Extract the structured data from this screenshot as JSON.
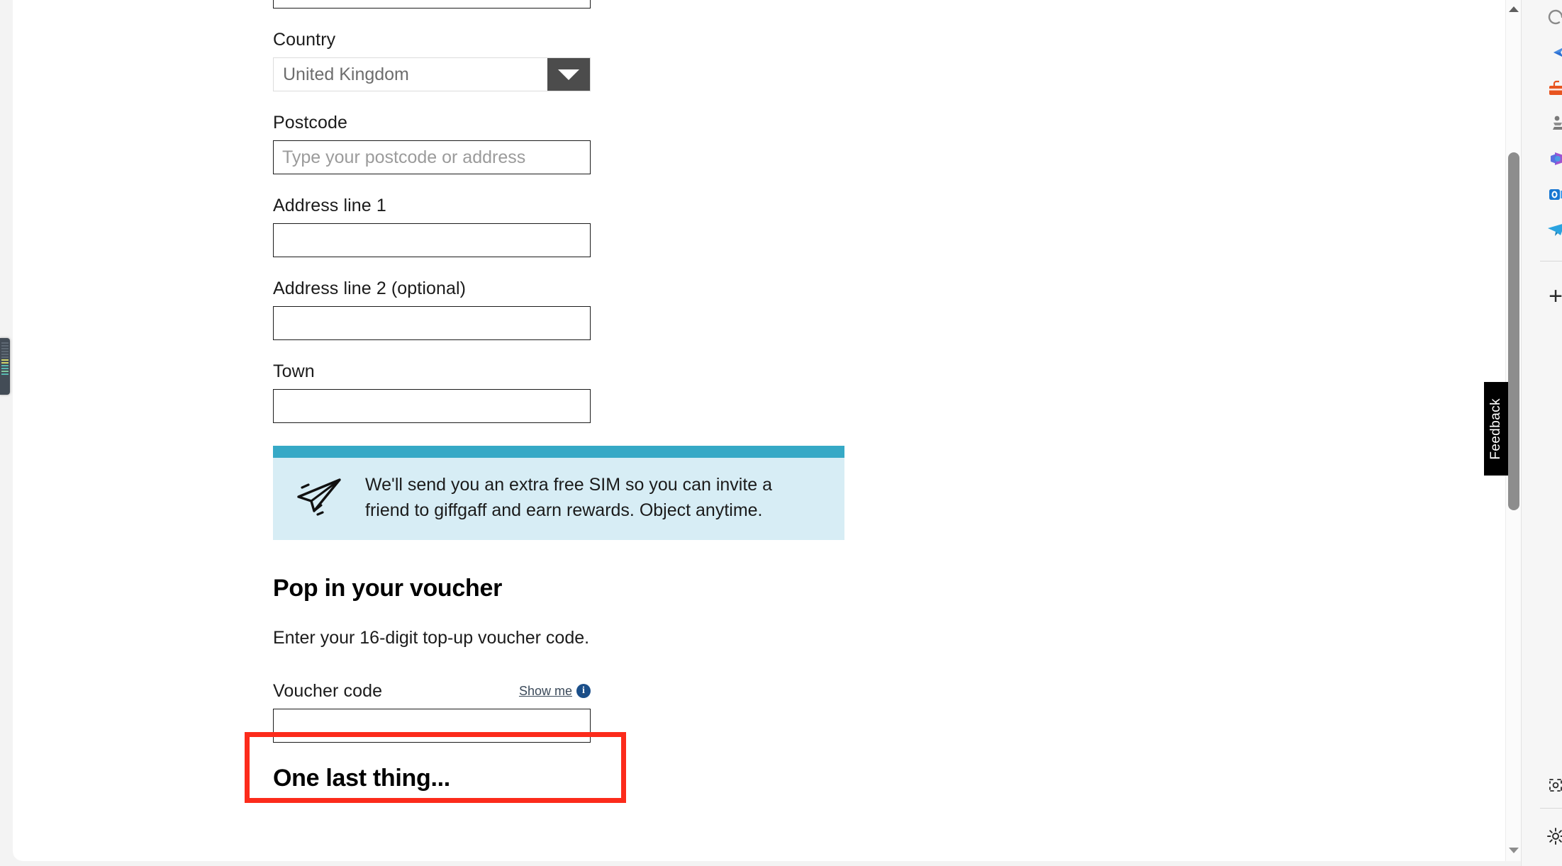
{
  "form": {
    "fields": [
      {
        "id": "top-cut-input",
        "label": "",
        "value": "",
        "placeholder": ""
      },
      {
        "id": "country",
        "label": "Country",
        "value": "United Kingdom",
        "placeholder": ""
      },
      {
        "id": "postcode",
        "label": "Postcode",
        "value": "",
        "placeholder": "Type your postcode or address"
      },
      {
        "id": "address-line-1",
        "label": "Address line 1",
        "value": "",
        "placeholder": ""
      },
      {
        "id": "address-line-2",
        "label": "Address line 2 (optional)",
        "value": "",
        "placeholder": ""
      },
      {
        "id": "town",
        "label": "Town",
        "value": "",
        "placeholder": ""
      }
    ]
  },
  "sim_banner": {
    "text": "We'll send you an extra free SIM so you can invite a friend to giffgaff and earn rewards. Object anytime.",
    "icon": "paper-plane-icon",
    "accent_color": "#36a9c6",
    "background_color": "#d7edf5"
  },
  "voucher": {
    "heading": "Pop in your voucher",
    "subtext": "Enter your 16-digit top-up voucher code.",
    "field_label": "Voucher code",
    "show_me_label": "Show me",
    "info_icon_glyph": "i",
    "input_value": "",
    "input_placeholder": ""
  },
  "last_section": {
    "heading": "One last thing..."
  },
  "annotation": {
    "color": "#fc2b1b",
    "target": "voucher-code-input"
  },
  "feedback_tab": {
    "label": "Feedback"
  },
  "page_scrollbar": {
    "up_arrow": "scroll-up-arrow",
    "down_arrow": "scroll-down-arrow"
  },
  "edge_sidebar": {
    "items": [
      {
        "name": "copilot-icon",
        "glyph": "◐",
        "color": "#8a8a8a"
      },
      {
        "name": "edge-drop-icon",
        "glyph": "◆",
        "color": "#2b6fd4"
      },
      {
        "name": "tools-icon",
        "glyph": "▣",
        "color": "#e8541f"
      },
      {
        "name": "games-icon",
        "glyph": "♟",
        "color": "#7a7a7a"
      },
      {
        "name": "office-icon",
        "glyph": "◈",
        "color": "#a052d0"
      },
      {
        "name": "outlook-icon",
        "glyph": "◎",
        "color": "#1877d2"
      },
      {
        "name": "telegram-icon",
        "glyph": "➤",
        "color": "#2aa3e0"
      }
    ],
    "add_app_label": "+",
    "customize_icon": "customize-sidebar-icon",
    "settings_icon": "gear-icon"
  }
}
